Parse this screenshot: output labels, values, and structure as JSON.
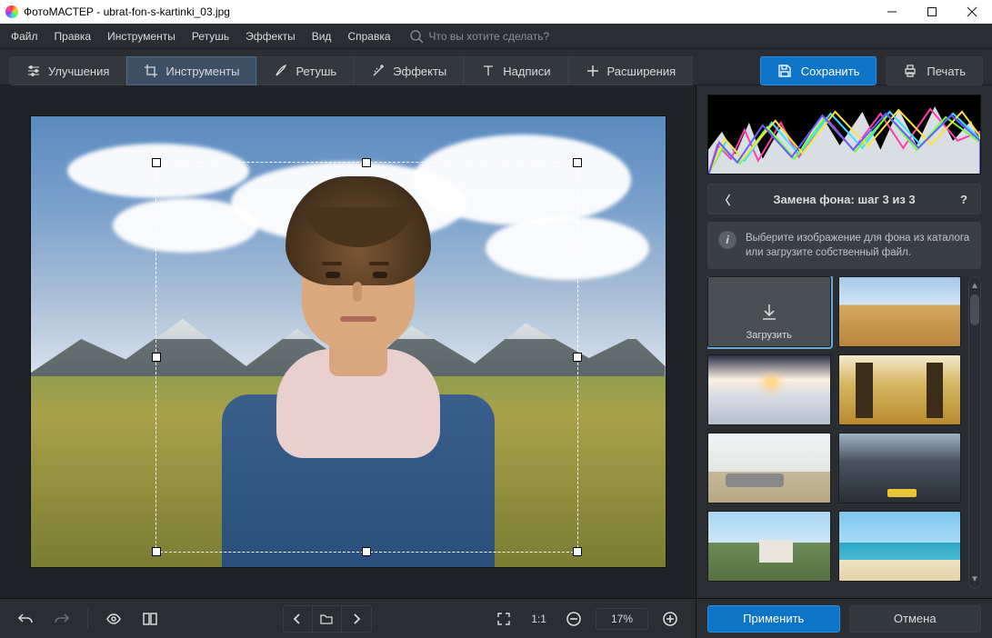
{
  "title": "ФотоМАСТЕР - ubrat-fon-s-kartinki_03.jpg",
  "menu": {
    "file": "Файл",
    "edit": "Правка",
    "tools": "Инструменты",
    "retouch": "Ретушь",
    "effects": "Эффекты",
    "view": "Вид",
    "help": "Справка",
    "search_placeholder": "Что вы хотите сделать?"
  },
  "tabs": {
    "enhance": "Улучшения",
    "tools": "Инструменты",
    "retouch": "Ретушь",
    "effects": "Эффекты",
    "text": "Надписи",
    "ext": "Расширения"
  },
  "actions": {
    "save": "Сохранить",
    "print": "Печать"
  },
  "zoom": {
    "value": "17%",
    "ratio": "1:1"
  },
  "panel": {
    "title": "Замена фона: шаг 3 из 3",
    "info": "Выберите изображение для фона из каталога или загрузите собственный файл.",
    "upload": "Загрузить"
  },
  "buttons": {
    "apply": "Применить",
    "cancel": "Отмена"
  }
}
